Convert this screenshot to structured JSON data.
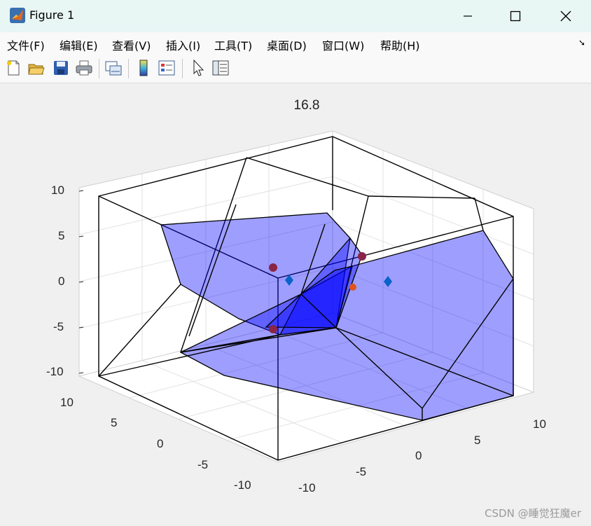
{
  "window": {
    "title": "Figure 1",
    "controls": [
      "—",
      "☐",
      "✕"
    ]
  },
  "menu": [
    "文件(F)",
    "编辑(E)",
    "查看(V)",
    "插入(I)",
    "工具(T)",
    "桌面(D)",
    "窗口(W)",
    "帮助(H)"
  ],
  "toolbar": {
    "icons": [
      "new-figure-icon",
      "open-file-icon",
      "save-icon",
      "print-icon",
      "link-plot-icon",
      "insert-colorbar-icon",
      "insert-legend-icon",
      "edit-plot-arrow-icon",
      "property-inspector-icon"
    ]
  },
  "plot": {
    "title": "16.8",
    "z_ticks": [
      "10",
      "5",
      "0",
      "-5",
      "-10"
    ],
    "y_ticks": [
      "10",
      "5",
      "0",
      "-5",
      "-10"
    ],
    "x_ticks": [
      "-10",
      "-5",
      "0",
      "5",
      "10"
    ],
    "face_color": "#0000ff",
    "face_alpha": 0.38,
    "edge_color": "#000000"
  },
  "watermark": "CSDN @睡觉狂魔er"
}
